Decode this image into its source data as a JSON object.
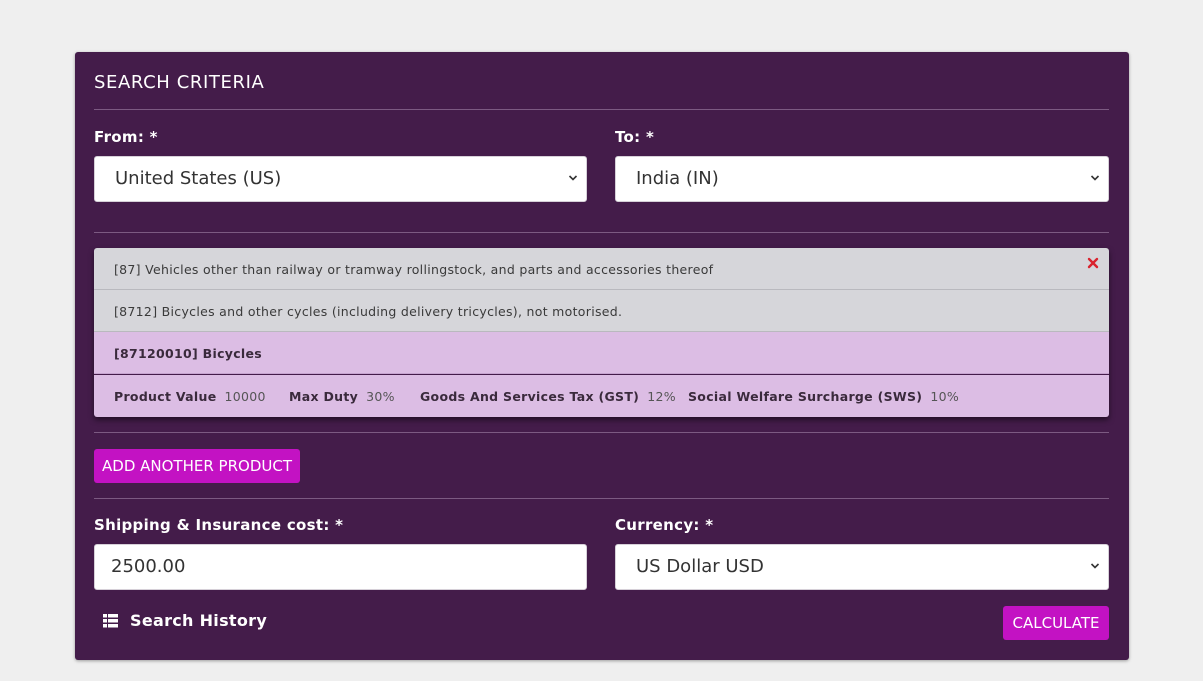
{
  "panel": {
    "title": "SEARCH CRITERIA"
  },
  "from": {
    "label": "From: *",
    "value": "United States (US)"
  },
  "to": {
    "label": "To: *",
    "value": "India (IN)"
  },
  "product": {
    "chapter": "[87] Vehicles other than railway or tramway rollingstock, and parts and accessories thereof",
    "heading": "[8712] Bicycles and other cycles (including delivery tricycles), not motorised.",
    "item": "[87120010] Bicycles",
    "stats": [
      {
        "label": "Product Value",
        "value": "10000"
      },
      {
        "label": "Max Duty",
        "value": "30%"
      },
      {
        "label": "Goods And Services Tax (GST)",
        "value": "12%"
      },
      {
        "label": "Social Welfare Surcharge (SWS)",
        "value": "10%"
      }
    ]
  },
  "add_product_label": "ADD ANOTHER PRODUCT",
  "shipping": {
    "label": "Shipping & Insurance cost: *",
    "value": "2500.00"
  },
  "currency": {
    "label": "Currency: *",
    "value": "US Dollar USD"
  },
  "history_label": "Search History",
  "calculate_label": "CALCULATE",
  "colors": {
    "panel": "#441c4a",
    "accent": "#c312c3",
    "close": "#d9232e"
  }
}
